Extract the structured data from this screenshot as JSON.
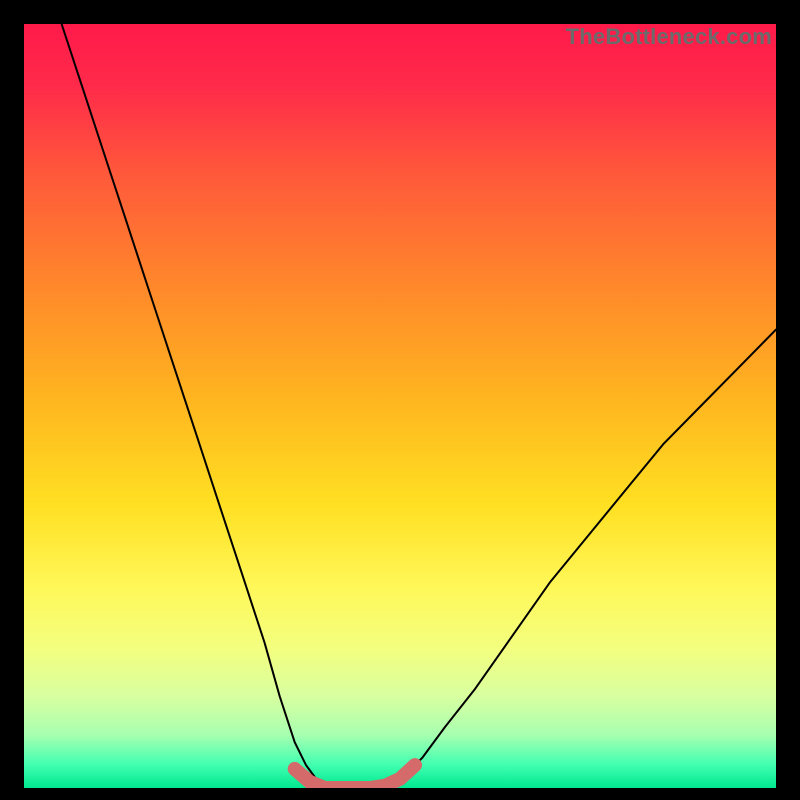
{
  "watermark": "TheBottleneck.com",
  "chart_data": {
    "type": "line",
    "title": "",
    "xlabel": "",
    "ylabel": "",
    "xlim": [
      0,
      100
    ],
    "ylim": [
      0,
      100
    ],
    "grid": false,
    "legend": false,
    "series": [
      {
        "name": "curve",
        "x": [
          5,
          8,
          11,
          14,
          17,
          20,
          23,
          26,
          29,
          32,
          34,
          36,
          37.5,
          39,
          41,
          44,
          47,
          50,
          53,
          56,
          60,
          65,
          70,
          75,
          80,
          85,
          90,
          95,
          100
        ],
        "y": [
          100,
          91,
          82,
          73,
          64,
          55,
          46,
          37,
          28,
          19,
          12,
          6,
          3,
          1,
          0,
          0,
          0,
          1,
          4,
          8,
          13,
          20,
          27,
          33,
          39,
          45,
          50,
          55,
          60
        ]
      },
      {
        "name": "flat-highlight",
        "x": [
          36,
          38,
          40,
          42,
          44,
          46,
          48,
          50,
          52
        ],
        "y": [
          2.5,
          0.8,
          0,
          0,
          0,
          0,
          0.3,
          1.2,
          3
        ]
      }
    ],
    "gradient_stops": [
      {
        "offset": 0.0,
        "color": "#ff1a4a"
      },
      {
        "offset": 0.08,
        "color": "#ff2a4a"
      },
      {
        "offset": 0.2,
        "color": "#ff5a3a"
      },
      {
        "offset": 0.35,
        "color": "#ff8a2a"
      },
      {
        "offset": 0.5,
        "color": "#ffb81f"
      },
      {
        "offset": 0.63,
        "color": "#ffe022"
      },
      {
        "offset": 0.74,
        "color": "#fff85a"
      },
      {
        "offset": 0.82,
        "color": "#f2ff80"
      },
      {
        "offset": 0.88,
        "color": "#d8ffa0"
      },
      {
        "offset": 0.93,
        "color": "#a8ffb0"
      },
      {
        "offset": 0.97,
        "color": "#40ffb0"
      },
      {
        "offset": 1.0,
        "color": "#00e890"
      }
    ],
    "colors": {
      "curve_stroke": "#000000",
      "highlight_stroke": "#d46a6a"
    }
  }
}
